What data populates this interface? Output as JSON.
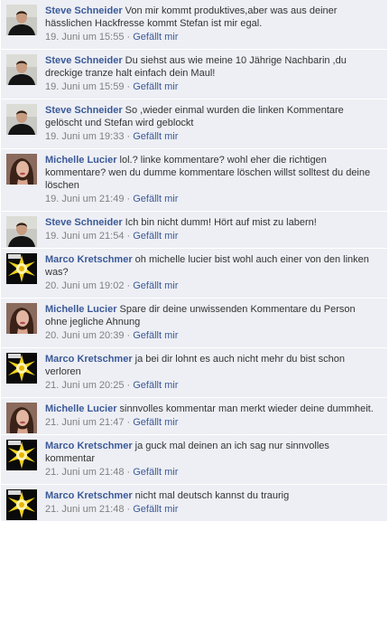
{
  "colors": {
    "link": "#3b5998",
    "comment_bg": "#edeff4",
    "meta": "#808080",
    "text": "#333333"
  },
  "like_label": "Gefällt mir",
  "separator": "·",
  "comments": [
    {
      "author": "Steve Schneider",
      "avatar": "avatar-steve",
      "text": "Von mir kommt produktives,aber was aus deiner hässlichen Hackfresse kommt Stefan ist mir egal.",
      "time": "19. Juni um 15:55"
    },
    {
      "author": "Steve Schneider",
      "avatar": "avatar-steve",
      "text": "Du siehst aus wie meine 10 Jährige Nachbarin ,du dreckige tranze halt einfach dein Maul!",
      "time": "19. Juni um 15:59"
    },
    {
      "author": "Steve Schneider",
      "avatar": "avatar-steve",
      "text": "So ,wieder einmal wurden die linken Kommentare gelöscht und Stefan wird geblockt",
      "time": "19. Juni um 19:33"
    },
    {
      "author": "Michelle Lucier",
      "avatar": "avatar-michelle",
      "text": "lol.? linke kommentare? wohl eher die richtigen kommentare? wen du dumme kommentare löschen willst solltest du deine löschen",
      "time": "19. Juni um 21:49"
    },
    {
      "author": "Steve Schneider",
      "avatar": "avatar-steve",
      "text": "Ich bin nicht dumm! Hört auf mist zu labern!",
      "time": "19. Juni um 21:54"
    },
    {
      "author": "Marco Kretschmer",
      "avatar": "avatar-marco",
      "text": "oh michelle lucier bist wohl auch einer von den linken was?",
      "time": "20. Juni um 19:02"
    },
    {
      "author": "Michelle Lucier",
      "avatar": "avatar-michelle",
      "text": "Spare dir deine unwissenden Kommentare du Person ohne jegliche Ahnung",
      "time": "20. Juni um 20:39"
    },
    {
      "author": "Marco Kretschmer",
      "avatar": "avatar-marco",
      "text": "ja bei dir lohnt es auch nicht mehr du bist schon verloren",
      "time": "21. Juni um 20:25"
    },
    {
      "author": "Michelle Lucier",
      "avatar": "avatar-michelle",
      "text": "sinnvolles kommentar man merkt wieder deine dummheit.",
      "time": "21. Juni um 21:47"
    },
    {
      "author": "Marco Kretschmer",
      "avatar": "avatar-marco",
      "text": "ja guck mal deinen an ich sag nur sinnvolles kommentar",
      "time": "21. Juni um 21:48"
    },
    {
      "author": "Marco Kretschmer",
      "avatar": "avatar-marco",
      "text": "nicht mal deutsch kannst du traurig",
      "time": "21. Juni um 21:48"
    }
  ]
}
